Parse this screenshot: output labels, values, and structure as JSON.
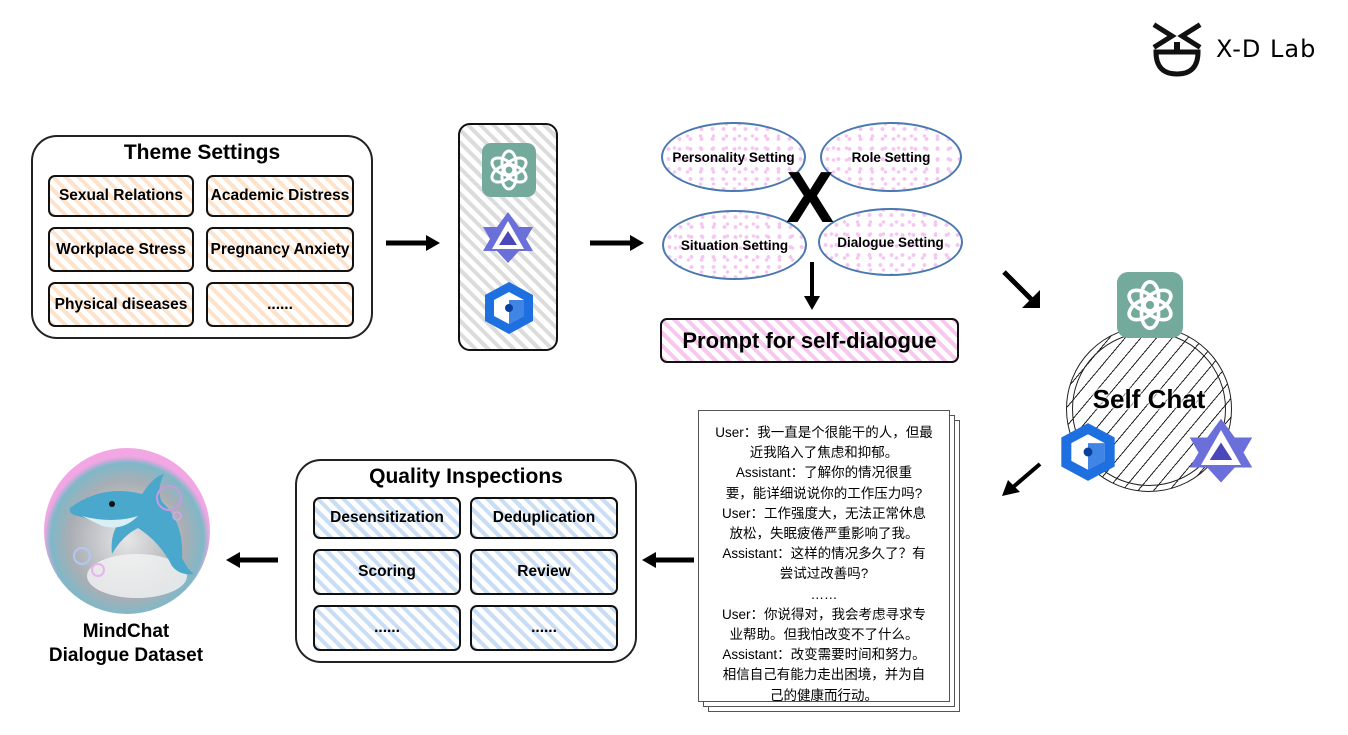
{
  "logo": {
    "icon": "xd-face-logo-icon",
    "text": "X-D Lab"
  },
  "theme_settings": {
    "title": "Theme Settings",
    "color": "#fde3cc",
    "items": [
      "Sexual Relations",
      "Academic Distress",
      "Workplace Stress",
      "Pregnancy Anxiety",
      "Physical diseases",
      "......"
    ]
  },
  "models": [
    {
      "name": "ChatGPT",
      "icon": "openai-logo-icon",
      "color": "#74aa9c"
    },
    {
      "name": "Qwen",
      "icon": "qwen-logo-icon",
      "color": "#5b5fd6"
    },
    {
      "name": "Wenxin",
      "icon": "hexagon-cube-logo-icon",
      "color": "#1e6fe0"
    }
  ],
  "settings": {
    "items": [
      "Personality Setting",
      "Role Setting",
      "Situation Setting",
      "Dialogue Setting"
    ],
    "combine_symbol": "X",
    "prompt_label": "Prompt for self-dialogue",
    "ellipse_border": "#4a78b0",
    "dot_color": "#f6c6f2"
  },
  "self_chat": {
    "label": "Self Chat"
  },
  "dialogue": {
    "lines": [
      "User：我一直是个很能干的人，但最",
      "近我陷入了焦虑和抑郁。",
      "Assistant：了解你的情况很重",
      "要，能详细说说你的工作压力吗?",
      "User：工作强度大，无法正常休息",
      "放松，失眠疲倦严重影响了我。",
      "Assistant：这样的情况多久了？有",
      "尝试过改善吗?",
      "……",
      "User：你说得对，我会考虑寻求专",
      "业帮助。但我怕改变不了什么。",
      "Assistant：改变需要时间和努力。",
      "相信自己有能力走出困境，并为自",
      "己的健康而行动。"
    ]
  },
  "quality_inspections": {
    "title": "Quality Inspections",
    "color": "#c9def5",
    "items": [
      "Desensitization",
      "Deduplication",
      "Scoring",
      "Review",
      "......",
      "......"
    ]
  },
  "dataset": {
    "image": "dolphin-in-bubble-image",
    "line1": "MindChat",
    "line2": "Dialogue Dataset"
  }
}
